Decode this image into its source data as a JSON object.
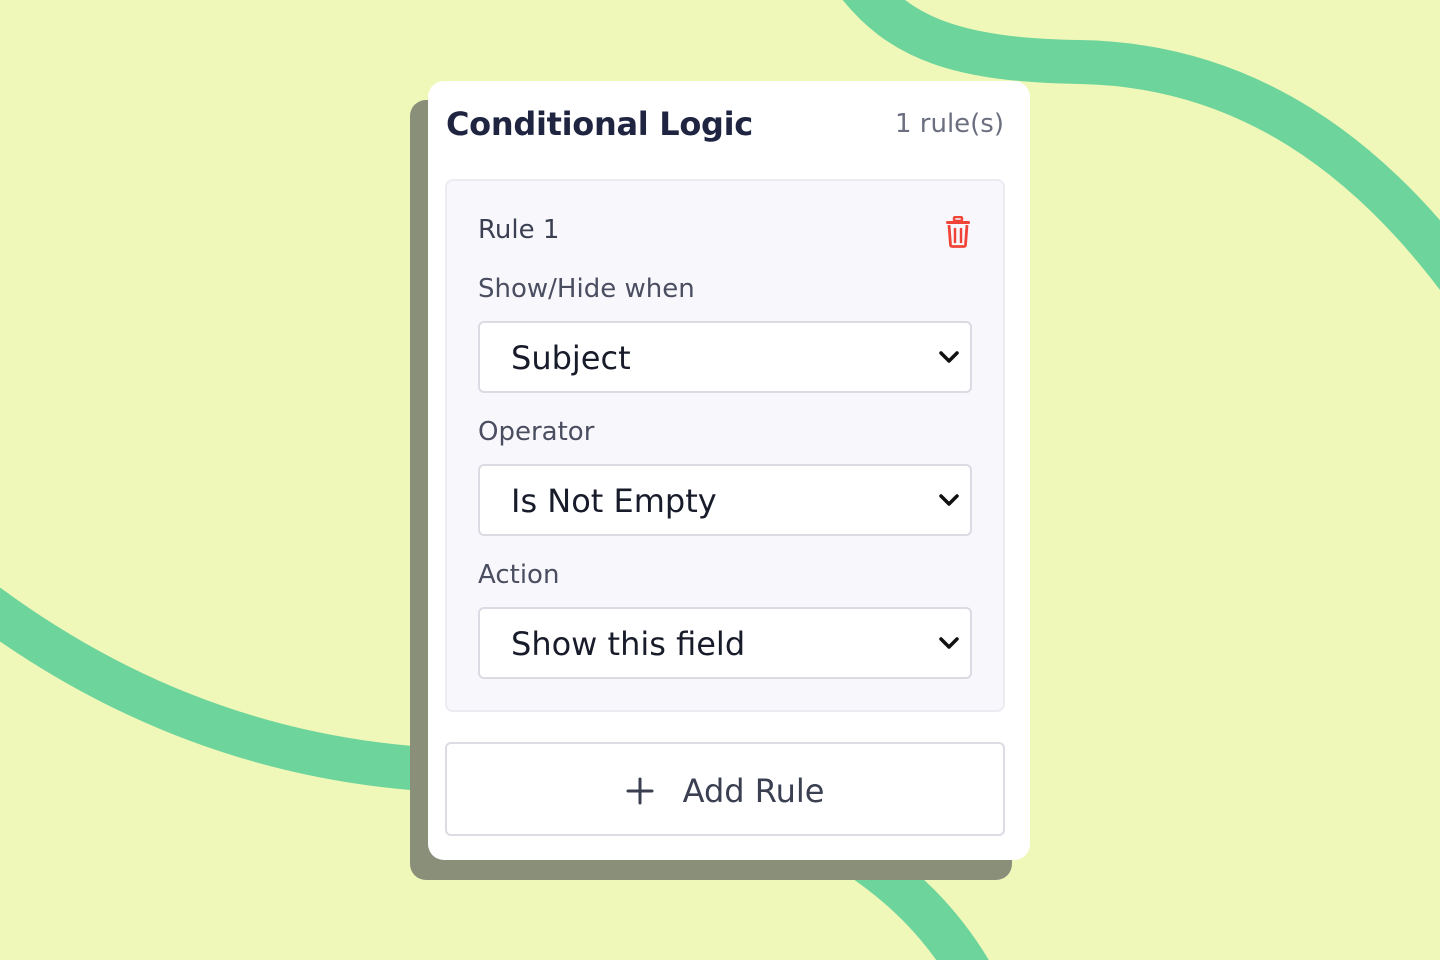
{
  "colors": {
    "background": "#eff8b8",
    "curve": "#6dd49c",
    "card": "#ffffff",
    "shadow": "#8a8f7a",
    "delete_icon": "#f04438",
    "title": "#1f2540"
  },
  "panel": {
    "title": "Conditional Logic",
    "rule_count": "1 rule(s)"
  },
  "rules": [
    {
      "title": "Rule 1",
      "delete_icon": "trash-icon",
      "show_hide_label": "Show/Hide when",
      "field_value": "Subject",
      "operator_label": "Operator",
      "operator_value": "Is Not Empty",
      "action_label": "Action",
      "action_value": "Show this field"
    }
  ],
  "add_rule": {
    "icon": "plus-icon",
    "label": "Add Rule"
  }
}
